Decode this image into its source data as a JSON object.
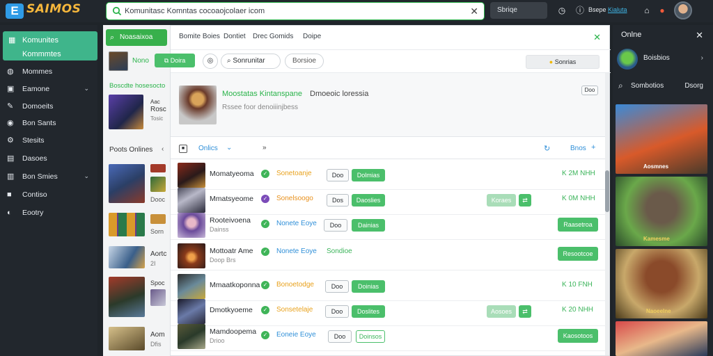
{
  "app": {
    "logo_badge": "E",
    "logo_text": "SAIMOS"
  },
  "topbar": {
    "search_value": "Komunitasc Komntas cocoaojcolaer icom",
    "region_label": "Sbriqe",
    "user_label": "Bsepe",
    "user_link": "Kialuta"
  },
  "sidebar": {
    "items": [
      {
        "label": "Komunites",
        "sub": "Kommmtes",
        "icon": "grid-icon"
      },
      {
        "label": "Mommes",
        "icon": "globe-icon"
      },
      {
        "label": "Eamone",
        "icon": "briefcase-icon",
        "chevron": true
      },
      {
        "label": "Domoeits",
        "icon": "thumbs-up-icon"
      },
      {
        "label": "Bon Sants",
        "icon": "chat-icon"
      },
      {
        "label": "Stesits",
        "icon": "gear-icon"
      },
      {
        "label": "Dasoes",
        "icon": "calendar-icon"
      },
      {
        "label": "Bon Smies",
        "icon": "box-icon",
        "chevron": true
      },
      {
        "label": "Contiso",
        "icon": "camera-icon"
      },
      {
        "label": "Eootry",
        "icon": "eye-icon"
      }
    ]
  },
  "col2": {
    "btn_label": "Noasaixoa",
    "badge_name": "Nono",
    "section_title": "Boscdte hosesocto",
    "list_title": "Poots Onlines",
    "item_labels": [
      "Aac",
      "Rosc",
      "Dooc",
      "Sorn",
      "Aortc",
      "Spoc",
      "Aom"
    ],
    "item_subs": [
      "Tosic",
      "",
      "",
      "",
      "",
      "",
      "Dfis"
    ]
  },
  "modal": {
    "tabs": [
      "Bomite Boies",
      "Dontiet",
      "Drec Gomids",
      "Doipe"
    ],
    "green_btn": "Doira",
    "pill_1": "Sonrunitar",
    "pill_2": "Borsioe",
    "right_pill": "Sonrias",
    "feature_title": "Moostatas Kintanspane",
    "feature_title_extra": "Dmoeoic loressia",
    "feature_sub": "Rssee foor denoiiinjbess",
    "feature_badge": "Doo",
    "sort_label": "Onlics",
    "sort_right": "Bnos",
    "rows": [
      {
        "name": "Momatyeoma",
        "check": "#3fb458",
        "tag": "Sonetoanje",
        "tag_color": "#e8a11c",
        "pill": "Doo",
        "btn": "Dolmias",
        "light": "",
        "stat": "K 2M NHH"
      },
      {
        "name": "Mmatsyeome",
        "check": "#7b4bb8",
        "tag": "Sonelsoogo",
        "tag_color": "#e8901c",
        "pill": "Dos",
        "btn": "Daoslies",
        "light": "Koraes",
        "stat": "K 0M NHH"
      },
      {
        "name": "Rooteivoena",
        "check": "#3fb458",
        "tag": "Nonete Eoye",
        "tag_color": "#2f8fd8",
        "pill": "Doo",
        "btn": "Dainias",
        "light": "",
        "stat": "Raasetroa",
        "sub": "Dainss"
      },
      {
        "name": "Mottoatr Ame",
        "check": "#3fb458",
        "tag": "Nonete Eoye",
        "tag_color": "#2f8fd8",
        "pill": "",
        "btn": "Sondioe",
        "light": "",
        "stat": "Resootcoe",
        "sub": "Doop Brs"
      },
      {
        "name": "Mmaatkoponna",
        "check": "#3fb458",
        "tag": "Bonoetodge",
        "tag_color": "#e8a11c",
        "pill": "Doo",
        "btn": "Doinias",
        "light": "",
        "stat": "K 10 FNH"
      },
      {
        "name": "Dmotkyoeme",
        "check": "#3fb458",
        "tag": "Sonsetelaje",
        "tag_color": "#e8a11c",
        "pill": "Doo",
        "btn": "Doslites",
        "light": "Aosoes",
        "stat": "K 20 NHH"
      },
      {
        "name": "Mamdoopema",
        "check": "#3fb458",
        "tag": "Eoneie Eoye",
        "tag_color": "#2f8fd8",
        "pill": "Doo",
        "btn": "Doinsos",
        "light": "",
        "stat": "Kaosotoos",
        "sub": "Drioo"
      }
    ]
  },
  "rpanel": {
    "title": "Onlne",
    "user_name": "Boisbios",
    "section_label": "Sombotios",
    "section_right": "Dsorg",
    "cards": [
      "Aosmnes",
      "Kamesme",
      "Naoeelne",
      ""
    ]
  }
}
